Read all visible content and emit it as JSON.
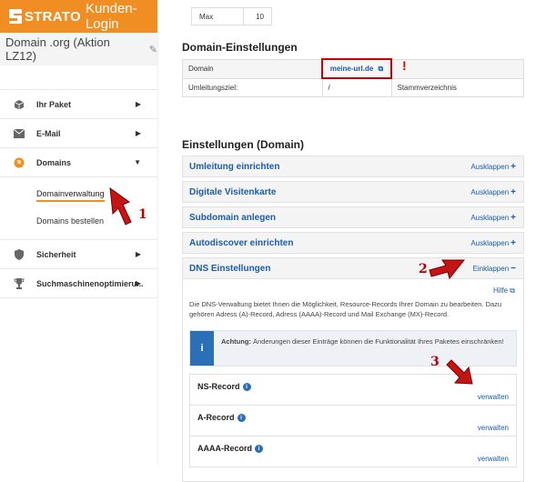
{
  "brand": {
    "name": "STRATO",
    "subtitle": "Kunden-Login"
  },
  "domain_title": "Domain .org (Aktion LZ12)",
  "sidebar": {
    "items": [
      {
        "label": "Ihr Paket",
        "icon": "box-icon"
      },
      {
        "label": "E-Mail",
        "icon": "envelope-icon"
      },
      {
        "label": "Domains",
        "icon": "globe-icon",
        "expanded": true
      },
      {
        "label": "Sicherheit",
        "icon": "shield-icon"
      },
      {
        "label": "Suchmaschinenoptimieru...",
        "icon": "trophy-icon"
      }
    ],
    "sub_items": [
      {
        "label": "Domainverwaltung",
        "active": true
      },
      {
        "label": "Domains bestellen",
        "active": false
      }
    ]
  },
  "top_table": {
    "label": "Max",
    "value": "10"
  },
  "domain_settings": {
    "title": "Domain-Einstellungen",
    "rows": [
      {
        "label": "Domain",
        "value": "meine-url.de",
        "extra": ""
      },
      {
        "label": "Umleitungsziel:",
        "value": "/",
        "extra": "Stammverzeichnis"
      }
    ]
  },
  "settings": {
    "title": "Einstellungen (Domain)",
    "expand_label": "Ausklappen",
    "collapse_label": "Einklappen",
    "accordions": [
      {
        "label": "Umleitung einrichten"
      },
      {
        "label": "Digitale Visitenkarte"
      },
      {
        "label": "Subdomain anlegen"
      },
      {
        "label": "Autodiscover einrichten"
      }
    ],
    "dns": {
      "label": "DNS Einstellungen",
      "help": "Hilfe",
      "description": "Die DNS-Verwaltung bietet Ihnen die Möglichkeit, Resource-Records Ihrer Domain zu bearbeiten. Dazu gehören Adress (A)-Record, Adress (AAAA)-Record und Mail Exchange (MX)-Record.",
      "alert_bold": "Achtung:",
      "alert_text": "Änderungen dieser Einträge können die Funktionalität Ihres Paketes einschränken!",
      "records": [
        {
          "name": "NS-Record",
          "action": "verwalten"
        },
        {
          "name": "A-Record",
          "action": "verwalten"
        },
        {
          "name": "AAAA-Record",
          "action": "verwalten"
        }
      ]
    }
  },
  "annotations": [
    "1",
    "2",
    "3",
    "!"
  ]
}
